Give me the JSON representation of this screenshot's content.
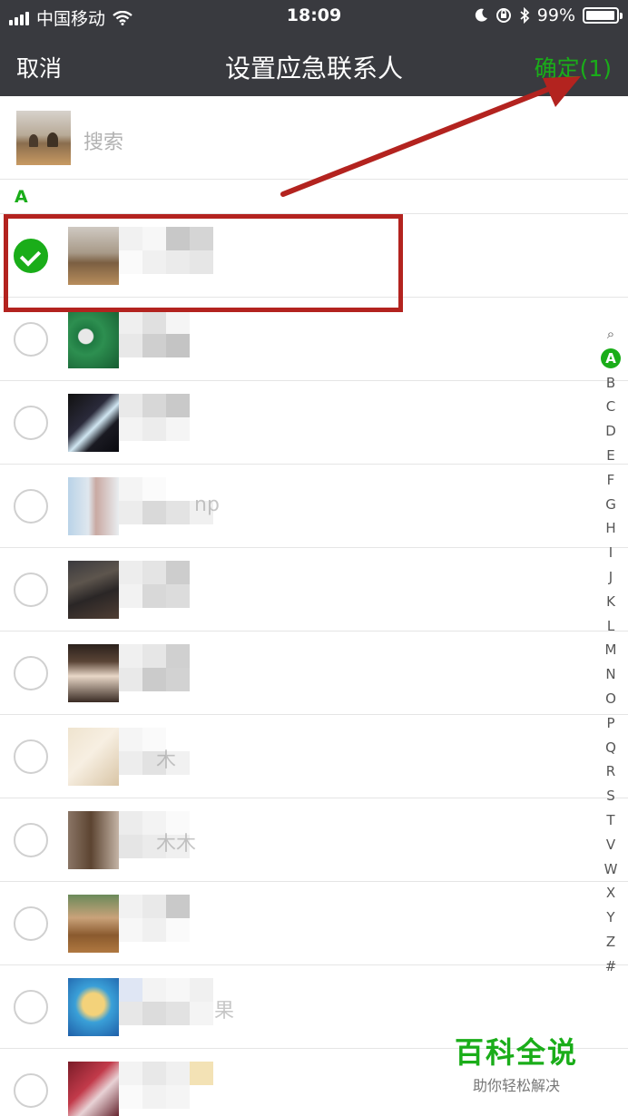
{
  "status_bar": {
    "carrier": "中国移动",
    "time": "18:09",
    "battery": "99%",
    "icons": [
      "signal-icon",
      "wifi-icon",
      "moon-icon",
      "orientation-lock-icon",
      "bluetooth-icon",
      "battery-icon"
    ]
  },
  "navbar": {
    "cancel_label": "取消",
    "title": "设置应急联系人",
    "confirm_label": "确定(1)"
  },
  "search": {
    "placeholder": "搜索"
  },
  "section": {
    "letter": "A"
  },
  "contacts": [
    {
      "name_visible": "",
      "checked": true
    },
    {
      "name_visible": "",
      "checked": false
    },
    {
      "name_visible": "",
      "checked": false
    },
    {
      "name_visible": "np",
      "checked": false
    },
    {
      "name_visible": "",
      "checked": false
    },
    {
      "name_visible": "",
      "checked": false
    },
    {
      "name_visible": "木",
      "checked": false
    },
    {
      "name_visible": "木木",
      "checked": false
    },
    {
      "name_visible": "",
      "checked": false
    },
    {
      "name_visible": "果",
      "checked": false
    },
    {
      "name_visible": "",
      "checked": false
    }
  ],
  "index_bar": {
    "search_glyph": "⌕",
    "letters": [
      "A",
      "B",
      "C",
      "D",
      "E",
      "F",
      "G",
      "H",
      "I",
      "J",
      "K",
      "L",
      "M",
      "N",
      "O",
      "P",
      "Q",
      "R",
      "S",
      "T",
      "V",
      "W",
      "X",
      "Y",
      "Z",
      "#"
    ],
    "active": "A"
  },
  "watermark": {
    "title": "百科全说",
    "subtitle": "助你轻松解决"
  },
  "colors": {
    "accent": "#1aad19",
    "nav_bg": "#393a3f",
    "annotation": "#b3231f"
  }
}
